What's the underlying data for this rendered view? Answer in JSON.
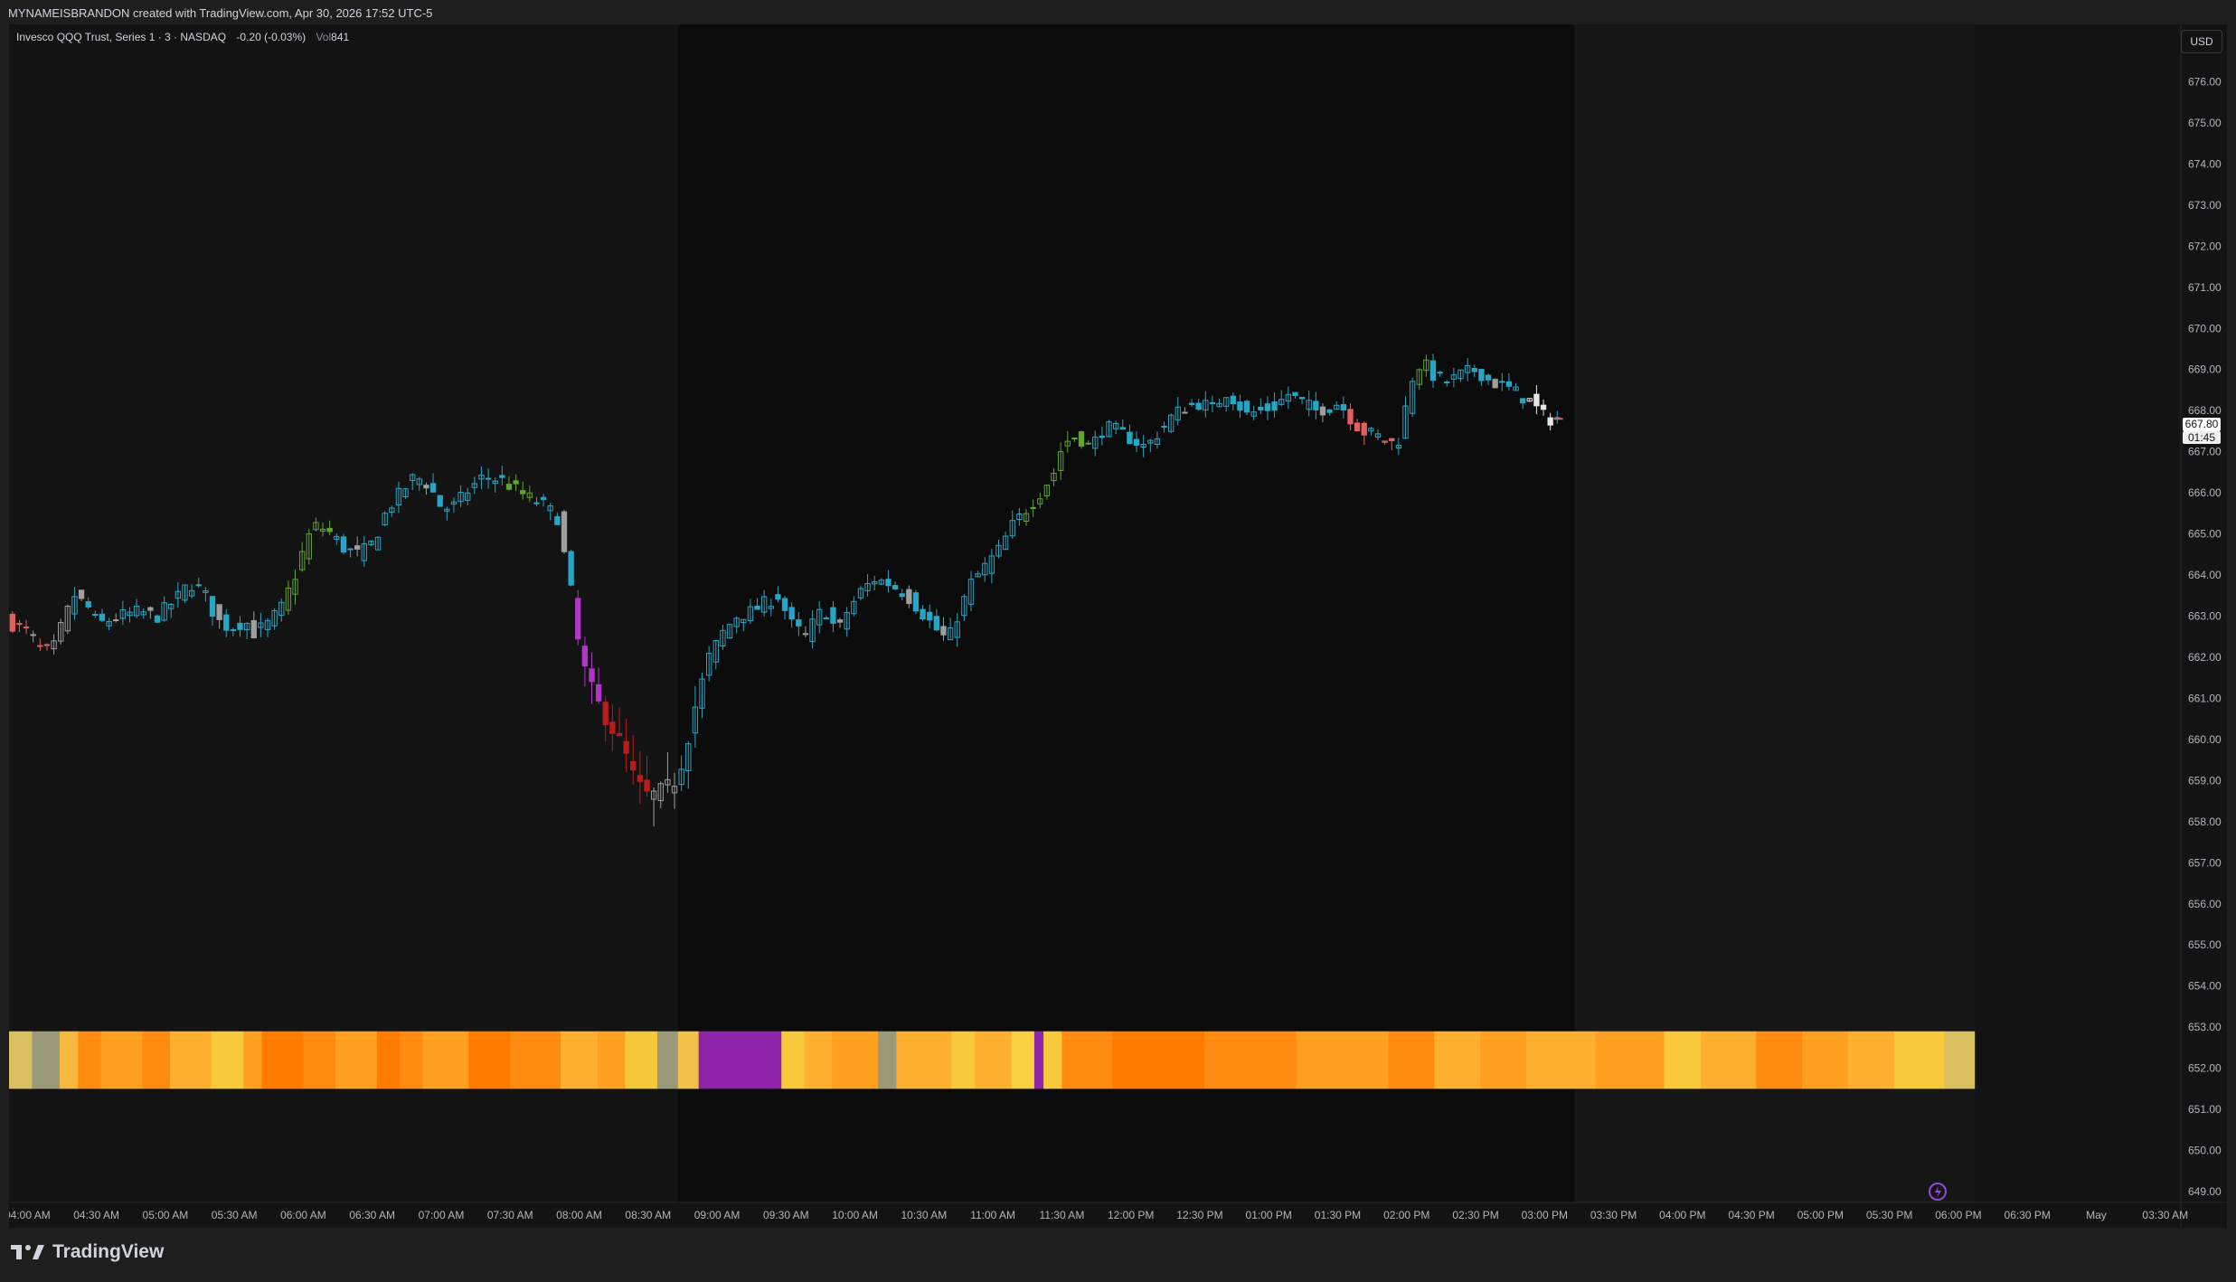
{
  "header": {
    "caption": "MYNAMEISBRANDON created with TradingView.com, Apr 30, 2026 17:52 UTC-5"
  },
  "legend": {
    "symbol": "Invesco QQQ Trust, Series 1 · 3 · NASDAQ",
    "change": "-0.20 (-0.03%)",
    "vol_label": "Vol",
    "vol_value": "841"
  },
  "currency_button": "USD",
  "last_price": {
    "price": "667.80",
    "countdown": "01:45"
  },
  "branding": {
    "logo_text": "TradingView"
  },
  "colors": {
    "background": "#131313",
    "session_bg": "#0b0b0b",
    "axis_text": "#b2b5be",
    "up_cyan": "#26a6c4",
    "up_green": "#5fa52e",
    "gray": "#9e9e9e",
    "red_light": "#e06060",
    "red_dark": "#b81d1d",
    "magenta": "#b036c8",
    "yellow": "#d7d62a",
    "white": "#e6e6e6",
    "heat_orange": "#ff7b00",
    "heat_yellow": "#f8c93a",
    "heat_purple": "#8e24aa"
  },
  "chart_data": {
    "type": "candlestick",
    "y_axis": {
      "min": 649,
      "max": 677,
      "tick_labels": [
        "676.00",
        "675.00",
        "674.00",
        "673.00",
        "672.00",
        "671.00",
        "670.00",
        "669.00",
        "668.00",
        "667.00",
        "666.00",
        "665.00",
        "664.00",
        "663.00",
        "662.00",
        "661.00",
        "660.00",
        "659.00",
        "658.00",
        "657.00",
        "656.00",
        "655.00",
        "654.00",
        "653.00",
        "652.00",
        "651.00",
        "650.00",
        "649.00"
      ],
      "tick_values": [
        676,
        675,
        674,
        673,
        672,
        671,
        670,
        669,
        668,
        667,
        666,
        665,
        664,
        663,
        662,
        661,
        660,
        659,
        658,
        657,
        656,
        655,
        654,
        653,
        652,
        651,
        650,
        649
      ]
    },
    "x_axis": {
      "bar_minutes": 3,
      "start_time": "03:52 AM",
      "tick_labels": [
        "04:00 AM",
        "04:30 AM",
        "05:00 AM",
        "05:30 AM",
        "06:00 AM",
        "06:30 AM",
        "07:00 AM",
        "07:30 AM",
        "08:00 AM",
        "08:30 AM",
        "09:00 AM",
        "09:30 AM",
        "10:00 AM",
        "10:30 AM",
        "11:00 AM",
        "11:30 AM",
        "12:00 PM",
        "12:30 PM",
        "01:00 PM",
        "01:30 PM",
        "02:00 PM",
        "02:30 PM",
        "03:00 PM",
        "03:30 PM",
        "04:00 PM",
        "04:30 PM",
        "05:00 PM",
        "05:30 PM",
        "06:00 PM",
        "06:30 PM",
        "May",
        "03:30 AM"
      ],
      "tick_minutes": [
        8,
        38,
        68,
        98,
        128,
        158,
        188,
        218,
        248,
        278,
        308,
        338,
        368,
        398,
        428,
        458,
        488,
        518,
        548,
        578,
        608,
        638,
        668,
        698,
        728,
        758,
        788,
        818,
        848,
        878,
        908,
        938
      ]
    },
    "sessions": [
      {
        "name": "regular",
        "start_minute": 291,
        "end_minute": 681
      },
      {
        "name": "post-market",
        "start_minute": 681,
        "end_minute": 855
      }
    ],
    "price_waypoints": [
      [
        0,
        662.9
      ],
      [
        10,
        662.6
      ],
      [
        15,
        662.2
      ],
      [
        20,
        662.1
      ],
      [
        26,
        663.0
      ],
      [
        30,
        663.5
      ],
      [
        36,
        663.2
      ],
      [
        40,
        662.8
      ],
      [
        50,
        663.0
      ],
      [
        58,
        663.1
      ],
      [
        66,
        663.0
      ],
      [
        74,
        663.4
      ],
      [
        80,
        663.8
      ],
      [
        86,
        663.6
      ],
      [
        92,
        662.9
      ],
      [
        98,
        662.7
      ],
      [
        104,
        662.9
      ],
      [
        108,
        662.6
      ],
      [
        114,
        662.8
      ],
      [
        120,
        663.2
      ],
      [
        126,
        664.0
      ],
      [
        130,
        664.7
      ],
      [
        134,
        665.2
      ],
      [
        140,
        665.1
      ],
      [
        148,
        664.6
      ],
      [
        154,
        664.5
      ],
      [
        160,
        664.8
      ],
      [
        166,
        665.6
      ],
      [
        172,
        666.0
      ],
      [
        178,
        666.4
      ],
      [
        184,
        666.2
      ],
      [
        190,
        665.6
      ],
      [
        196,
        665.7
      ],
      [
        200,
        666.0
      ],
      [
        208,
        666.4
      ],
      [
        216,
        666.3
      ],
      [
        224,
        666.0
      ],
      [
        230,
        665.8
      ],
      [
        234,
        665.7
      ],
      [
        240,
        665.4
      ],
      [
        246,
        663.6
      ],
      [
        250,
        662.0
      ],
      [
        256,
        661.1
      ],
      [
        262,
        660.4
      ],
      [
        268,
        659.9
      ],
      [
        274,
        659.0
      ],
      [
        280,
        658.6
      ],
      [
        286,
        658.8
      ],
      [
        292,
        659.0
      ],
      [
        296,
        659.8
      ],
      [
        300,
        660.8
      ],
      [
        306,
        662.0
      ],
      [
        312,
        662.6
      ],
      [
        318,
        663.0
      ],
      [
        324,
        663.1
      ],
      [
        330,
        663.3
      ],
      [
        336,
        663.5
      ],
      [
        342,
        662.8
      ],
      [
        348,
        662.5
      ],
      [
        352,
        662.9
      ],
      [
        356,
        663.2
      ],
      [
        362,
        662.6
      ],
      [
        366,
        663.1
      ],
      [
        372,
        663.6
      ],
      [
        378,
        663.9
      ],
      [
        384,
        663.8
      ],
      [
        390,
        663.6
      ],
      [
        394,
        663.4
      ],
      [
        400,
        663.0
      ],
      [
        406,
        662.6
      ],
      [
        410,
        662.4
      ],
      [
        414,
        663.0
      ],
      [
        420,
        663.8
      ],
      [
        426,
        664.2
      ],
      [
        432,
        664.6
      ],
      [
        438,
        665.2
      ],
      [
        444,
        665.6
      ],
      [
        450,
        666.0
      ],
      [
        456,
        666.5
      ],
      [
        460,
        667.2
      ],
      [
        466,
        667.4
      ],
      [
        472,
        667.1
      ],
      [
        478,
        667.6
      ],
      [
        484,
        667.5
      ],
      [
        490,
        667.3
      ],
      [
        496,
        667.1
      ],
      [
        502,
        667.5
      ],
      [
        508,
        667.9
      ],
      [
        514,
        668.1
      ],
      [
        520,
        668.2
      ],
      [
        526,
        668.0
      ],
      [
        530,
        668.5
      ],
      [
        534,
        668.3
      ],
      [
        540,
        667.9
      ],
      [
        546,
        668.0
      ],
      [
        552,
        668.1
      ],
      [
        558,
        668.4
      ],
      [
        564,
        668.2
      ],
      [
        570,
        668.0
      ],
      [
        576,
        668.1
      ],
      [
        580,
        668.2
      ],
      [
        584,
        667.9
      ],
      [
        590,
        667.5
      ],
      [
        596,
        667.4
      ],
      [
        602,
        667.2
      ],
      [
        606,
        667.3
      ],
      [
        612,
        668.8
      ],
      [
        616,
        669.2
      ],
      [
        622,
        668.8
      ],
      [
        628,
        668.7
      ],
      [
        634,
        668.9
      ],
      [
        640,
        669.0
      ],
      [
        646,
        668.7
      ],
      [
        652,
        668.6
      ],
      [
        658,
        668.4
      ],
      [
        664,
        668.2
      ],
      [
        668,
        667.9
      ],
      [
        672,
        667.8
      ]
    ],
    "heat_strip": {
      "y_top": 652.9,
      "y_bottom": 651.5,
      "bands": [
        [
          0,
          10,
          "#d8c060"
        ],
        [
          10,
          22,
          "#9a9a7a"
        ],
        [
          22,
          30,
          "#f5b840"
        ],
        [
          30,
          40,
          "#ff8c10"
        ],
        [
          40,
          58,
          "#ffa020"
        ],
        [
          58,
          70,
          "#ff8c10"
        ],
        [
          70,
          88,
          "#ffb030"
        ],
        [
          88,
          102,
          "#f8c93a"
        ],
        [
          102,
          110,
          "#ffa020"
        ],
        [
          110,
          128,
          "#ff7b00"
        ],
        [
          128,
          142,
          "#ff8c10"
        ],
        [
          142,
          160,
          "#ffa020"
        ],
        [
          160,
          170,
          "#ff7b00"
        ],
        [
          170,
          180,
          "#ff8c10"
        ],
        [
          180,
          200,
          "#ffa020"
        ],
        [
          200,
          218,
          "#ff7b00"
        ],
        [
          218,
          240,
          "#ff8c10"
        ],
        [
          240,
          256,
          "#ffb030"
        ],
        [
          256,
          268,
          "#ffa020"
        ],
        [
          268,
          282,
          "#f5c83a"
        ],
        [
          282,
          291,
          "#9a9a7a"
        ],
        [
          291,
          300,
          "#f0c048"
        ],
        [
          300,
          336,
          "#8e24aa"
        ],
        [
          336,
          346,
          "#f8c93a"
        ],
        [
          346,
          358,
          "#ffb030"
        ],
        [
          358,
          378,
          "#ffa020"
        ],
        [
          378,
          386,
          "#9a9a7a"
        ],
        [
          386,
          410,
          "#ffb030"
        ],
        [
          410,
          420,
          "#f8c93a"
        ],
        [
          420,
          436,
          "#ffb030"
        ],
        [
          436,
          446,
          "#f8d040"
        ],
        [
          446,
          450,
          "#8e24aa"
        ],
        [
          450,
          458,
          "#f8c93a"
        ],
        [
          458,
          480,
          "#ff8c10"
        ],
        [
          480,
          520,
          "#ff7b00"
        ],
        [
          520,
          560,
          "#ff8c10"
        ],
        [
          560,
          600,
          "#ffa020"
        ],
        [
          600,
          620,
          "#ff8c10"
        ],
        [
          620,
          640,
          "#ffb030"
        ],
        [
          640,
          660,
          "#ffa020"
        ],
        [
          660,
          690,
          "#ffb030"
        ],
        [
          690,
          720,
          "#ffa020"
        ],
        [
          720,
          736,
          "#f8c93a"
        ],
        [
          736,
          760,
          "#ffb030"
        ],
        [
          760,
          780,
          "#ff8c10"
        ],
        [
          780,
          800,
          "#ffa020"
        ],
        [
          800,
          820,
          "#ffb030"
        ],
        [
          820,
          842,
          "#f8c93a"
        ],
        [
          842,
          855,
          "#d8c060"
        ]
      ]
    }
  }
}
